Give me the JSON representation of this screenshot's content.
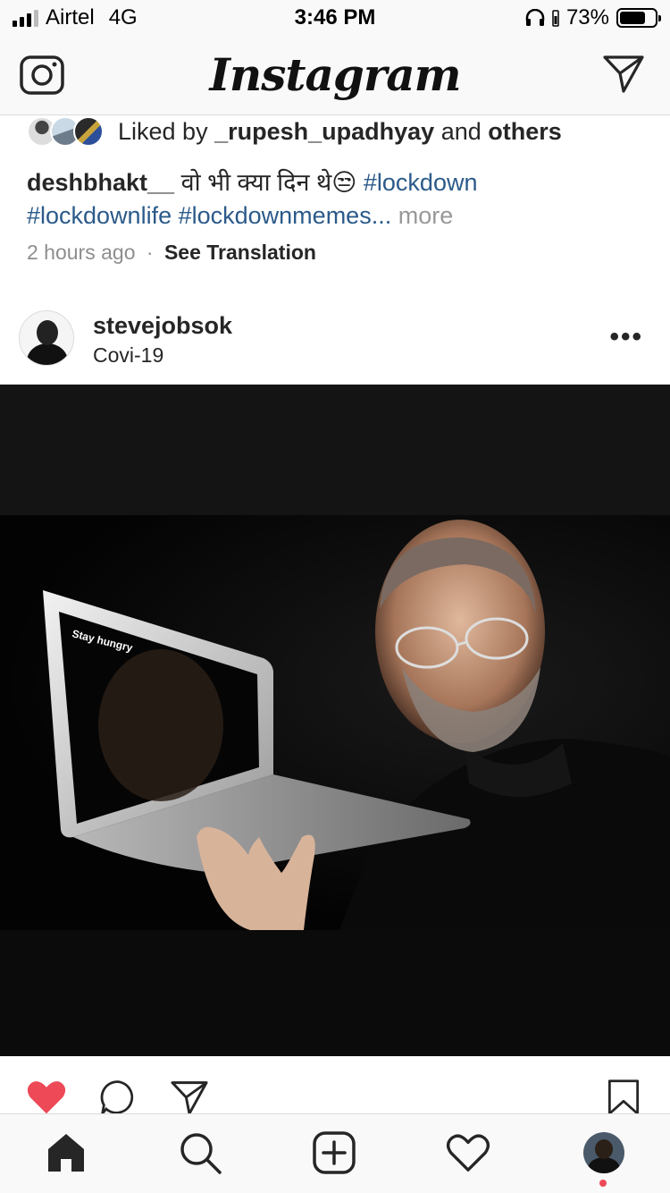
{
  "status_bar": {
    "carrier": "Airtel",
    "network": "4G",
    "time": "3:46 PM",
    "battery": "73%",
    "battery_level": 0.73
  },
  "header": {
    "logo": "Instagram",
    "icons": [
      "camera-icon",
      "direct-message-icon"
    ]
  },
  "previous_post": {
    "liked_by_prefix": "Liked by",
    "liked_by_user": "_rupesh_upadhyay",
    "liked_by_and": "and",
    "liked_by_others": "others",
    "caption_user": "deshbhakt__",
    "caption_text": "वो भी क्या दिन थे😒",
    "hashtag_1": "#lockdown",
    "hashtag_2": "#lockdownlife",
    "hashtag_3": "#lockdownmemes...",
    "more_label": "more",
    "time_ago": "2 hours ago",
    "separator": "·",
    "see_translation": "See Translation"
  },
  "post": {
    "username": "stevejobsok",
    "location": "Covi-19",
    "options_label": "•••",
    "image_text": "Stay hungry"
  },
  "actions": {
    "liked": true,
    "like_color": "#ed4956",
    "icons": [
      "heart-filled-icon",
      "comment-icon",
      "share-icon",
      "bookmark-icon"
    ]
  },
  "tab_bar": {
    "icons": [
      "home-icon",
      "search-icon",
      "new-post-icon",
      "activity-heart-icon",
      "profile-avatar"
    ],
    "notification_dot_color": "#ed4956"
  }
}
